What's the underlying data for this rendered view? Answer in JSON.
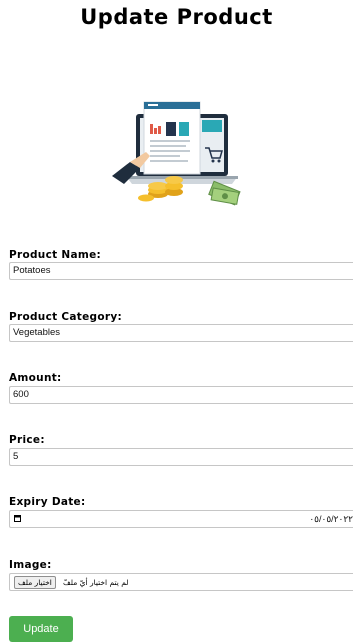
{
  "page": {
    "title": "Update Product"
  },
  "form": {
    "product_name": {
      "label": "Product Name:",
      "value": "Potatoes"
    },
    "product_category": {
      "label": "Product Category:",
      "value": "Vegetables"
    },
    "amount": {
      "label": "Amount:",
      "value": "600"
    },
    "price": {
      "label": "Price:",
      "value": "5"
    },
    "expiry_date": {
      "label": "Expiry Date:",
      "value": "٠٥/٠٥/٢٠٢٢"
    },
    "image": {
      "label": "Image:",
      "button_label": "اختيار ملف",
      "status_text": "لم يتم اختيار أيّ ملفّ"
    },
    "submit_label": "Update"
  },
  "colors": {
    "accent": "#4caf50"
  },
  "icons": {
    "illustration": "laptop-ecommerce-illustration",
    "calendar": "calendar-icon"
  }
}
